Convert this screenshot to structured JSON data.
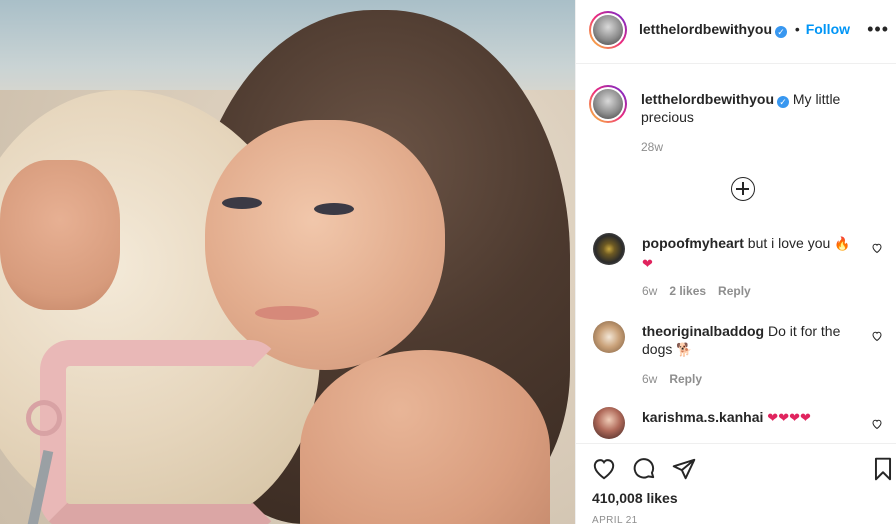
{
  "header": {
    "username": "letthelordbewithyou",
    "separator": "•",
    "follow_label": "Follow",
    "more_label": "•••"
  },
  "caption": {
    "username": "letthelordbewithyou",
    "text": "My little precious",
    "time": "28w"
  },
  "comments": [
    {
      "username": "popoofmyheart",
      "text": "but i love you",
      "emoji": "🔥",
      "emoji2": "❤",
      "time": "6w",
      "likes": "2 likes",
      "reply": "Reply"
    },
    {
      "username": "theoriginalbaddog",
      "text": "Do it for the dogs",
      "emoji": "🐕",
      "time": "6w",
      "reply": "Reply"
    },
    {
      "username": "karishma.s.kanhai",
      "emoji": "❤❤❤❤"
    }
  ],
  "footer": {
    "likes": "410,008 likes",
    "date": "APRIL 21"
  },
  "icons": {
    "verified": "verified-badge-icon",
    "like": "heart-icon",
    "comment": "comment-bubble-icon",
    "share": "paper-plane-icon",
    "save": "bookmark-icon",
    "add": "plus-circle-icon"
  },
  "colors": {
    "accent_blue": "#0095f6",
    "verified_blue": "#3897f0",
    "muted_text": "#8e8e8e",
    "heart_red": "#e0245e"
  }
}
